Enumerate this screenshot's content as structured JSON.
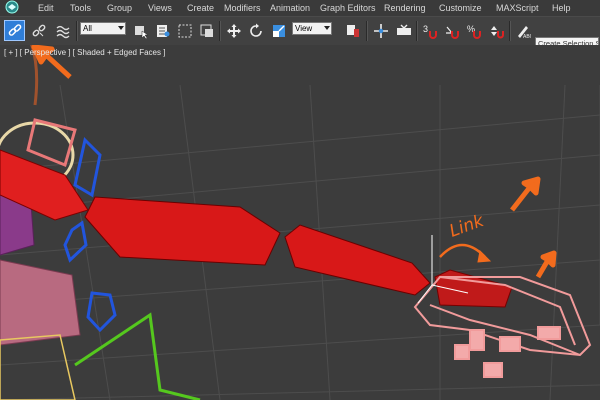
{
  "menubar": {
    "items": [
      "Edit",
      "Tools",
      "Group",
      "Views",
      "Create",
      "Modifiers",
      "Animation",
      "Graph Editors",
      "Rendering",
      "Customize",
      "MAXScript",
      "Help"
    ]
  },
  "toolbar": {
    "filter_dropdown": "All",
    "view_dropdown": "View",
    "selection_set_placeholder": "Create Selection Set",
    "buttons": [
      {
        "name": "select-and-link",
        "icon": "link-chain-icon",
        "active": true
      },
      {
        "name": "unlink-selection",
        "icon": "unlink-icon",
        "active": false
      },
      {
        "name": "bind-to-space-warp",
        "icon": "bind-spacewarp-icon",
        "active": false
      }
    ]
  },
  "viewport": {
    "label": "[ + ] [ Perspective ] [ Shaded + Edged Faces ]",
    "annotation": "Link"
  },
  "colors": {
    "annotation_orange": "#f26b1d",
    "active_button": "#2f7ed8",
    "selected_object": "#f19b9b",
    "bone_red": "#e01f1f",
    "helper_blue": "#2255dd",
    "grid_green": "#55c81e"
  }
}
